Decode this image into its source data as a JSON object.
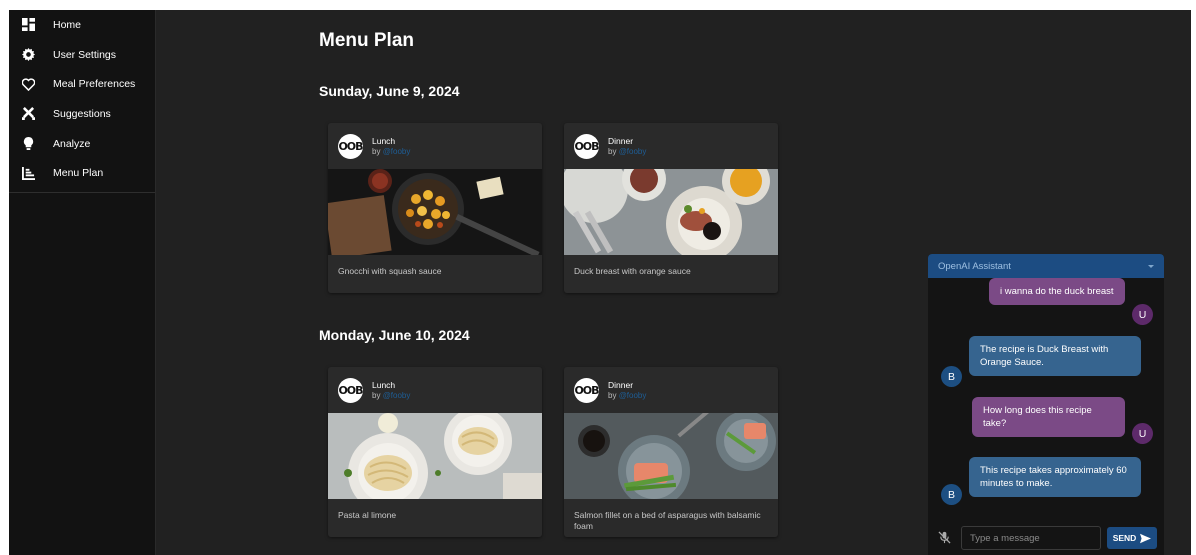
{
  "nav": {
    "items": [
      {
        "label": "Home",
        "icon": "dashboard-icon"
      },
      {
        "label": "User Settings",
        "icon": "gear-icon"
      },
      {
        "label": "Meal Preferences",
        "icon": "heart-icon"
      },
      {
        "label": "Suggestions",
        "icon": "utensils-icon"
      },
      {
        "label": "Analyze",
        "icon": "lightbulb-icon"
      },
      {
        "label": "Menu Plan",
        "icon": "menu-plan-icon"
      }
    ]
  },
  "main": {
    "title": "Menu Plan",
    "days": [
      {
        "date": "Sunday, June 9, 2024",
        "meals": [
          {
            "type": "Lunch",
            "by": "by",
            "author": "@fooby",
            "logo": "OOB",
            "name": "Gnocchi with squash sauce"
          },
          {
            "type": "Dinner",
            "by": "by",
            "author": "@fooby",
            "logo": "OOB",
            "name": "Duck breast with orange sauce"
          }
        ]
      },
      {
        "date": "Monday, June 10, 2024",
        "meals": [
          {
            "type": "Lunch",
            "by": "by",
            "author": "@fooby",
            "logo": "OOB",
            "name": "Pasta al limone"
          },
          {
            "type": "Dinner",
            "by": "by",
            "author": "@fooby",
            "logo": "OOB",
            "name": "Salmon fillet on a bed of asparagus with balsamic foam"
          }
        ]
      }
    ]
  },
  "chat": {
    "title": "OpenAI Assistant",
    "messages": [
      {
        "from": "user",
        "avatar": "U",
        "text": "i wanna do the duck breast"
      },
      {
        "from": "bot",
        "avatar": "B",
        "text": "The recipe is Duck Breast with Orange Sauce."
      },
      {
        "from": "user",
        "avatar": "U",
        "text": "How long does this recipe take?"
      },
      {
        "from": "bot",
        "avatar": "B",
        "text": "This recipe takes approximately 60 minutes to make."
      }
    ],
    "input_placeholder": "Type a message",
    "input_value": "",
    "send_label": "SEND"
  },
  "colors": {
    "background": "#212121",
    "sidebar": "#121212",
    "accent": "#1c4c82",
    "user_bubble": "#7b4a86",
    "bot_bubble": "#36648f"
  }
}
